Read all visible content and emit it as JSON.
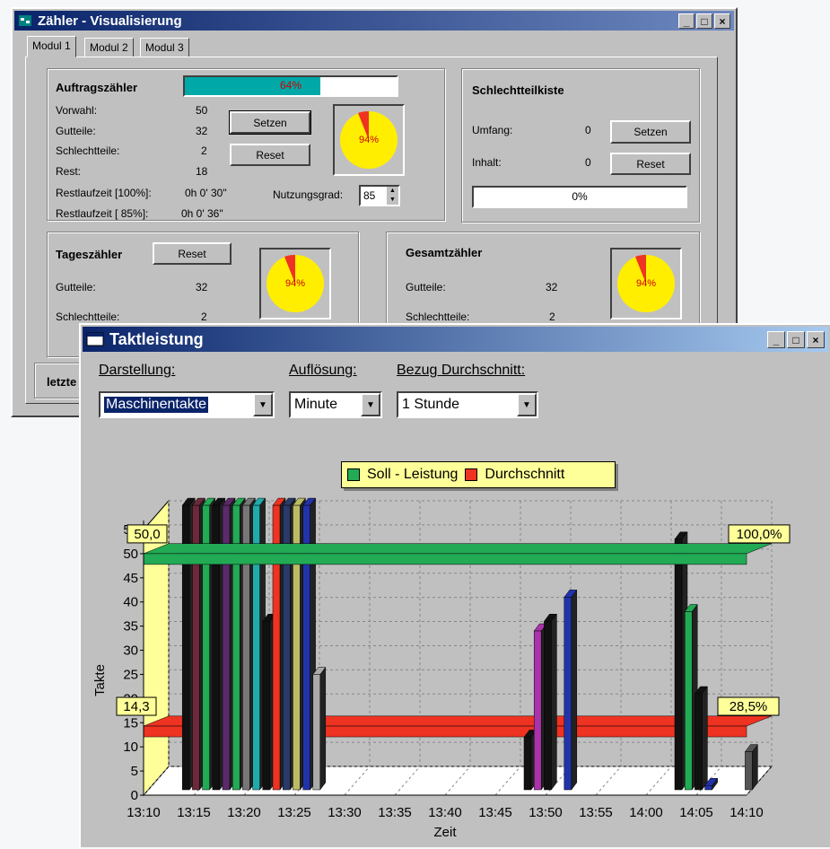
{
  "win1": {
    "title": "Zähler - Visualisierung",
    "tabs": [
      "Modul 1",
      "Modul 2",
      "Modul 3"
    ],
    "auftrag": {
      "title": "Auftragszähler",
      "progress_text": "64%",
      "progress": 0.64,
      "vorwahl_label": "Vorwahl:",
      "vorwahl": "50",
      "gutteile_label": "Gutteile:",
      "gutteile": "32",
      "schlecht_label": "Schlechtteile:",
      "schlecht": "2",
      "rest_label": "Rest:",
      "rest": "18",
      "rl100_label": "Restlaufzeit [100%]:",
      "rl100": "0h  0' 30\"",
      "rl85_label": "Restlaufzeit [ 85%]:",
      "rl85": "0h  0' 36\"",
      "setzen": "Setzen",
      "reset": "Reset",
      "pie_text": "94%",
      "nutzung_label": "Nutzungsgrad:",
      "nutzung": "85"
    },
    "kiste": {
      "title": "Schlechtteilkiste",
      "umfang_label": "Umfang:",
      "umfang": "0",
      "inhalt_label": "Inhalt:",
      "inhalt": "0",
      "setzen": "Setzen",
      "reset": "Reset",
      "bar_text": "0%"
    },
    "tag": {
      "title": "Tageszähler",
      "reset": "Reset",
      "gutteile_label": "Gutteile:",
      "gutteile": "32",
      "schlecht_label": "Schlechtteile:",
      "schlecht": "2",
      "pie_text": "94%"
    },
    "gesamt": {
      "title": "Gesamtzähler",
      "gutteile_label": "Gutteile:",
      "gutteile": "32",
      "schlecht_label": "Schlechtteile:",
      "schlecht": "2",
      "pie_text": "94%"
    },
    "bottom_label": "letzte"
  },
  "win2": {
    "title": "Taktleistung",
    "darstellung_label": "Darstellung:",
    "darstellung": "Maschinentakte",
    "aufloesung_label": "Auflösung:",
    "aufloesung": "Minute",
    "bezug_label": "Bezug Durchschnitt:",
    "bezug": "1 Stunde",
    "legend": [
      "Soll - Leistung",
      "Durchschnitt"
    ],
    "colors": {
      "soll": "#22aa55",
      "durchschnitt": "#ee3322"
    }
  },
  "chart_data": {
    "type": "bar",
    "xlabel": "Zeit",
    "ylabel": "Takte",
    "ylim": [
      0,
      55
    ],
    "yticks": [
      0,
      5,
      10,
      15,
      20,
      25,
      30,
      35,
      40,
      45,
      50,
      55
    ],
    "xticks": [
      "13:10",
      "13:15",
      "13:20",
      "13:25",
      "13:30",
      "13:35",
      "13:40",
      "13:45",
      "13:50",
      "13:55",
      "14:00",
      "14:05",
      "14:10"
    ],
    "soll_value": 50.0,
    "soll_label": "50,0",
    "soll_pct": "100,0%",
    "avg_value": 14.3,
    "avg_label": "14,3",
    "avg_pct": "28,5%",
    "bars": [
      {
        "t": 13.5,
        "v": 60,
        "c": "#111111"
      },
      {
        "t": 14.5,
        "v": 60,
        "c": "#6a2a3a"
      },
      {
        "t": 15.5,
        "v": 60,
        "c": "#22aa55"
      },
      {
        "t": 16.5,
        "v": 60,
        "c": "#111111"
      },
      {
        "t": 17.5,
        "v": 60,
        "c": "#5a2a6a"
      },
      {
        "t": 18.5,
        "v": 60,
        "c": "#22aa55"
      },
      {
        "t": 19.5,
        "v": 60,
        "c": "#777777"
      },
      {
        "t": 20.5,
        "v": 60,
        "c": "#22aaaa"
      },
      {
        "t": 21.5,
        "v": 36,
        "c": "#111111"
      },
      {
        "t": 22.5,
        "v": 60,
        "c": "#ee3322"
      },
      {
        "t": 23.5,
        "v": 60,
        "c": "#2a3a6a"
      },
      {
        "t": 24.5,
        "v": 60,
        "c": "#bbbb66"
      },
      {
        "t": 25.5,
        "v": 60,
        "c": "#2233aa"
      },
      {
        "t": 26.5,
        "v": 25,
        "c": "#aaaaaa"
      },
      {
        "t": 47.5,
        "v": 12,
        "c": "#111111"
      },
      {
        "t": 48.5,
        "v": 34,
        "c": "#aa33aa"
      },
      {
        "t": 49.5,
        "v": 36,
        "c": "#111111"
      },
      {
        "t": 51.5,
        "v": 41,
        "c": "#2233aa"
      },
      {
        "t": 62.5,
        "v": 53,
        "c": "#111111"
      },
      {
        "t": 63.5,
        "v": 38,
        "c": "#22aa55"
      },
      {
        "t": 64.5,
        "v": 21,
        "c": "#111111"
      },
      {
        "t": 65.5,
        "v": 2,
        "c": "#2233aa"
      },
      {
        "t": 69.5,
        "v": 9,
        "c": "#555555"
      }
    ]
  }
}
